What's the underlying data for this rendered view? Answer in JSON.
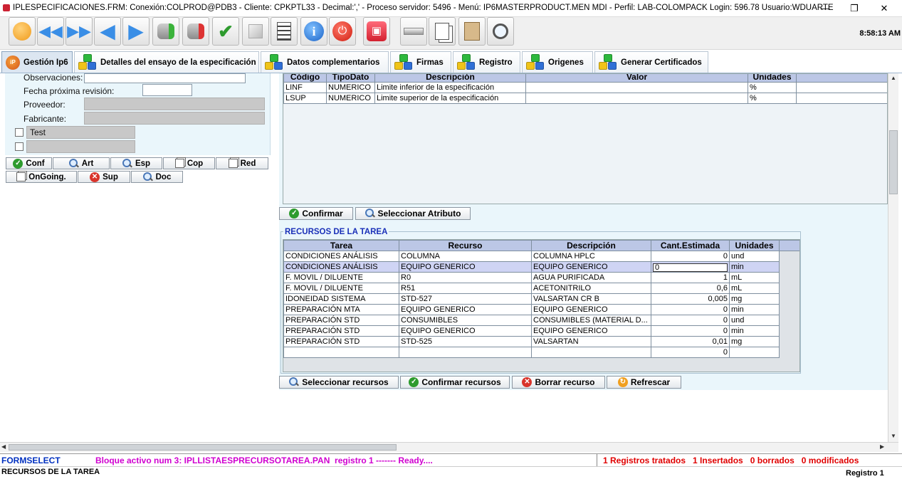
{
  "window": {
    "title": "IPLESPECIFICACIONES.FRM:      Conexión:COLPROD@PDB3 - Cliente: CPKPTL33 - Decimal:',' - Proceso servidor: 5496 - Menú: IP6MASTERPRODUCT.MEN MDI - Perfil: LAB-COLOMPACK Login: 596.78      Usuario:WDUARTE",
    "minimize": "—",
    "restore": "❐",
    "close": "✕"
  },
  "toolbar": {
    "clock": "8:58:13 AM",
    "buttons": [
      "return-icon",
      "rewind-icon",
      "fast-forward-icon",
      "prev-icon",
      "next-icon",
      "db-add-icon",
      "db-remove-icon",
      "checkmark-icon",
      "cube-icon",
      "list-icon",
      "info-icon",
      "power-icon",
      "lock-icon",
      "eraser-icon",
      "copy-icon",
      "paste-icon",
      "search-icon"
    ]
  },
  "tabs": [
    {
      "label": "Gestión Ip6"
    },
    {
      "label": "Detalles del ensayo de la especificación"
    },
    {
      "label": "Datos complementarios"
    },
    {
      "label": "Firmas"
    },
    {
      "label": "Registro"
    },
    {
      "label": "Origenes"
    },
    {
      "label": "Generar Certificados"
    }
  ],
  "form": {
    "observaciones_label": "Observaciones:",
    "fecha_label": "Fecha próxima revisión:",
    "proveedor_label": "Proveedor:",
    "fabricante_label": "Fabricante:",
    "test_label": "Test"
  },
  "left_buttons": {
    "conf": "Conf",
    "art": "Art",
    "esp": "Esp",
    "cop": "Cop",
    "red": "Red",
    "ongoing": "OnGoing.",
    "sup": "Sup",
    "doc": "Doc"
  },
  "attributes": {
    "columns": [
      "Código",
      "TipoDato",
      "Descripción",
      "Valor",
      "Unidades"
    ],
    "rows": [
      [
        "LINF",
        "NUMERICO",
        "Limite inferior de la especificación",
        "",
        "%"
      ],
      [
        "LSUP",
        "NUMERICO",
        "Limite superior de la especificación",
        "",
        "%"
      ]
    ],
    "confirm_label": "Confirmar",
    "select_label": "Seleccionar Atributo"
  },
  "resources": {
    "title": "RECURSOS DE LA TAREA",
    "columns": [
      "Tarea",
      "Recurso",
      "Descripción",
      "Cant.Estimada",
      "Unidades"
    ],
    "rows": [
      [
        "CONDICIONES ANÁLISIS",
        "COLUMNA",
        "COLUMNA HPLC",
        "0",
        "und"
      ],
      [
        "CONDICIONES ANÁLISIS",
        "EQUIPO GENERICO",
        "EQUIPO GENERICO",
        "0",
        "min"
      ],
      [
        "F. MOVIL / DILUENTE",
        "R0",
        "AGUA PURIFICADA",
        "1",
        "mL"
      ],
      [
        "F. MOVIL / DILUENTE",
        "R51",
        "ACETONITRILO",
        "0,6",
        "mL"
      ],
      [
        "IDONEIDAD SISTEMA",
        "STD-527",
        "VALSARTAN CR B",
        "0,005",
        "mg"
      ],
      [
        "PREPARACIÓN MTA",
        "EQUIPO GENERICO",
        "EQUIPO GENERICO",
        "0",
        "min"
      ],
      [
        "PREPARACIÓN STD",
        "CONSUMIBLES",
        "CONSUMIBLES (MATERIAL D...",
        "0",
        "und"
      ],
      [
        "PREPARACIÓN STD",
        "EQUIPO GENERICO",
        "EQUIPO GENERICO",
        "0",
        "min"
      ],
      [
        "PREPARACIÓN STD",
        "STD-525",
        "VALSARTAN",
        "0,01",
        "mg"
      ],
      [
        "",
        "",
        "",
        "0",
        ""
      ]
    ],
    "selected_row": 1,
    "buttons": {
      "select": "Seleccionar recursos",
      "confirm": "Confirmar recursos",
      "delete": "Borrar recurso",
      "refresh": "Refrescar"
    }
  },
  "statusbar": {
    "form": "FORMSELECT",
    "block": "Bloque activo num 3: IPLLISTAESPRECURSOTAREA.PAN  registro 1 ------- Ready....",
    "counts": "1 Registros tratados   1 Insertados   0 borrados   0 modificados",
    "section": "RECURSOS DE LA TAREA",
    "record": "Registro 1"
  },
  "colors": {
    "header": "#bcc7e6",
    "selected": "#cfd4f4",
    "panel": "#eaf6fb",
    "status_block": "#d000d0",
    "status_counts": "#e00000",
    "status_form": "#0030c0"
  }
}
